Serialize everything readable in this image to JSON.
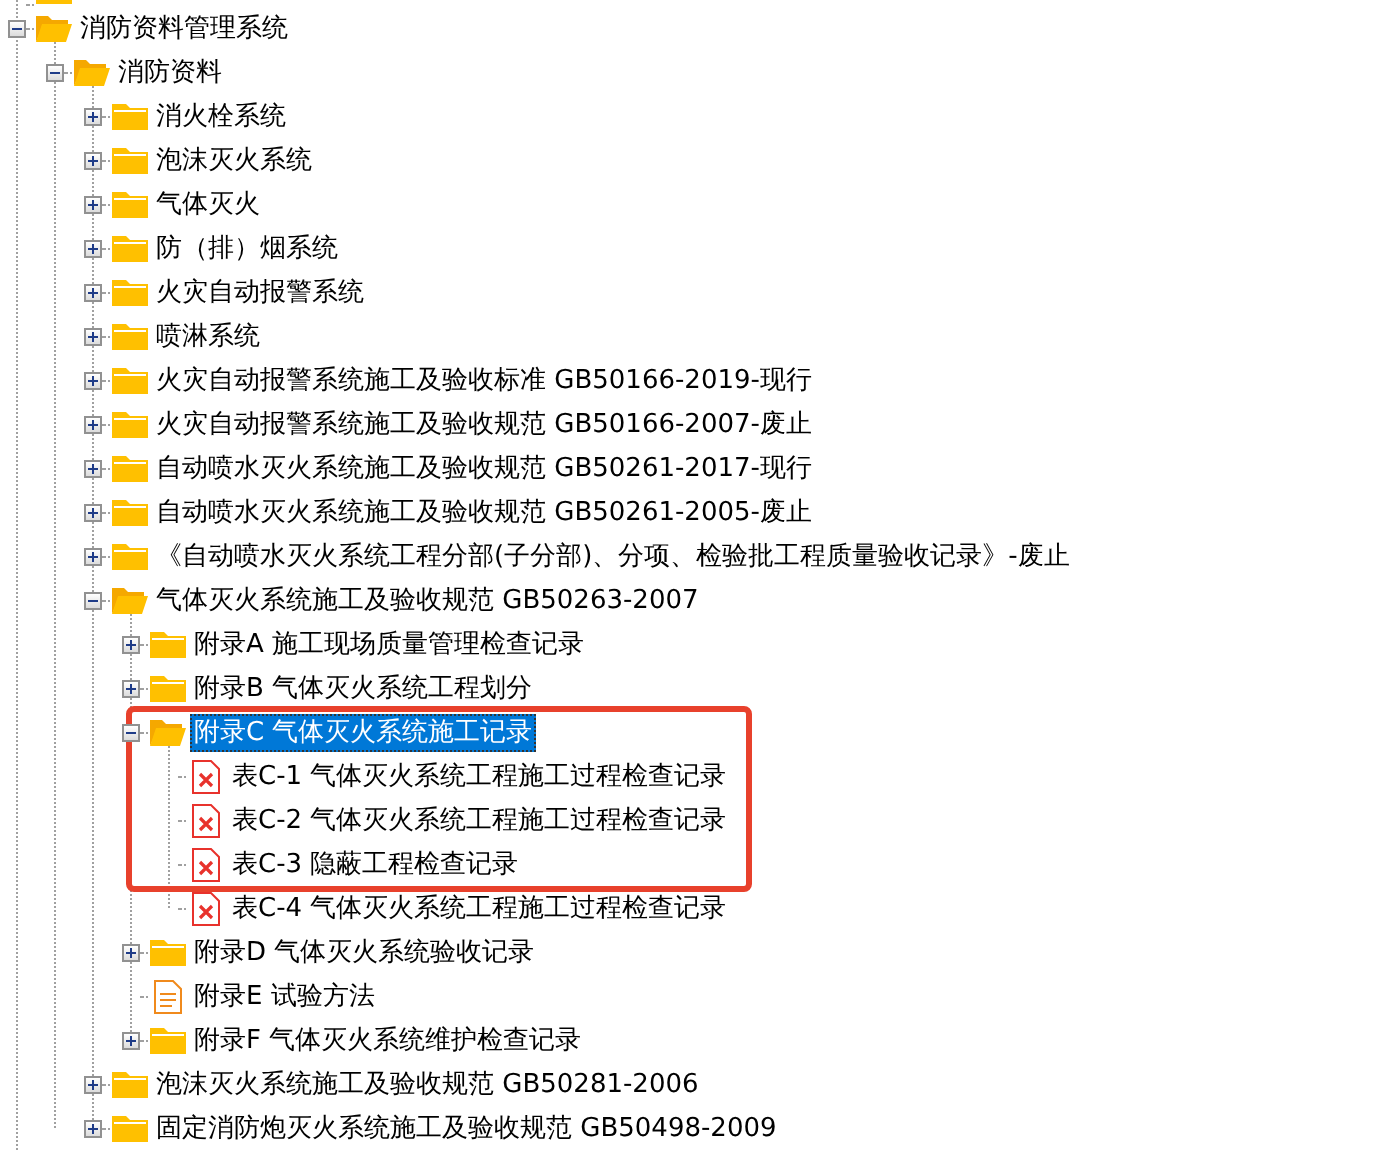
{
  "tree": [
    {
      "kind": "folder"
    },
    {
      "label": "消防资料管理系统",
      "kind": "folder",
      "expanded": true,
      "selected": false,
      "children": [
        {
          "label": "消防资料",
          "kind": "folder",
          "expanded": true,
          "selected": false,
          "children": [
            {
              "label": "消火栓系统",
              "kind": "folder",
              "expanded": false,
              "selected": false
            },
            {
              "label": "泡沫灭火系统",
              "kind": "folder",
              "expanded": false,
              "selected": false
            },
            {
              "label": "气体灭火",
              "kind": "folder",
              "expanded": false,
              "selected": false
            },
            {
              "label": "防（排）烟系统",
              "kind": "folder",
              "expanded": false,
              "selected": false
            },
            {
              "label": "火灾自动报警系统",
              "kind": "folder",
              "expanded": false,
              "selected": false
            },
            {
              "label": "喷淋系统",
              "kind": "folder",
              "expanded": false,
              "selected": false
            },
            {
              "label": "火灾自动报警系统施工及验收标准 GB50166-2019-现行",
              "kind": "folder",
              "expanded": false,
              "selected": false
            },
            {
              "label": "火灾自动报警系统施工及验收规范 GB50166-2007-废止",
              "kind": "folder",
              "expanded": false,
              "selected": false
            },
            {
              "label": "自动喷水灭火系统施工及验收规范 GB50261-2017-现行",
              "kind": "folder",
              "expanded": false,
              "selected": false
            },
            {
              "label": "自动喷水灭火系统施工及验收规范 GB50261-2005-废止",
              "kind": "folder",
              "expanded": false,
              "selected": false
            },
            {
              "label": "《自动喷水灭火系统工程分部(子分部)、分项、检验批工程质量验收记录》-废止",
              "kind": "folder",
              "expanded": false,
              "selected": false
            },
            {
              "label": "气体灭火系统施工及验收规范 GB50263-2007",
              "kind": "folder",
              "expanded": true,
              "selected": false,
              "children": [
                {
                  "label": "附录A 施工现场质量管理检查记录",
                  "kind": "folder",
                  "expanded": false,
                  "selected": false
                },
                {
                  "label": "附录B 气体灭火系统工程划分",
                  "kind": "folder",
                  "expanded": false,
                  "selected": false
                },
                {
                  "label": "附录C 气体灭火系统施工记录",
                  "kind": "folder",
                  "expanded": true,
                  "selected": true,
                  "children": [
                    {
                      "label": "表C-1 气体灭火系统工程施工过程检查记录",
                      "kind": "form",
                      "selected": false
                    },
                    {
                      "label": "表C-2 气体灭火系统工程施工过程检查记录",
                      "kind": "form",
                      "selected": false
                    },
                    {
                      "label": "表C-3 隐蔽工程检查记录",
                      "kind": "form",
                      "selected": false
                    },
                    {
                      "label": "表C-4 气体灭火系统工程施工过程检查记录",
                      "kind": "form",
                      "selected": false
                    }
                  ]
                },
                {
                  "label": "附录D 气体灭火系统验收记录",
                  "kind": "folder",
                  "expanded": false,
                  "selected": false
                },
                {
                  "label": "附录E 试验方法",
                  "kind": "document",
                  "selected": false
                },
                {
                  "label": "附录F 气体灭火系统维护检查记录",
                  "kind": "folder",
                  "expanded": false,
                  "selected": false
                }
              ]
            },
            {
              "label": "泡沫灭火系统施工及验收规范 GB50281-2006",
              "kind": "folder",
              "expanded": false,
              "selected": false
            },
            {
              "label": "固定消防炮灭火系统施工及验收规范 GB50498-2009",
              "kind": "folder",
              "expanded": false,
              "selected": false
            }
          ]
        }
      ]
    }
  ]
}
